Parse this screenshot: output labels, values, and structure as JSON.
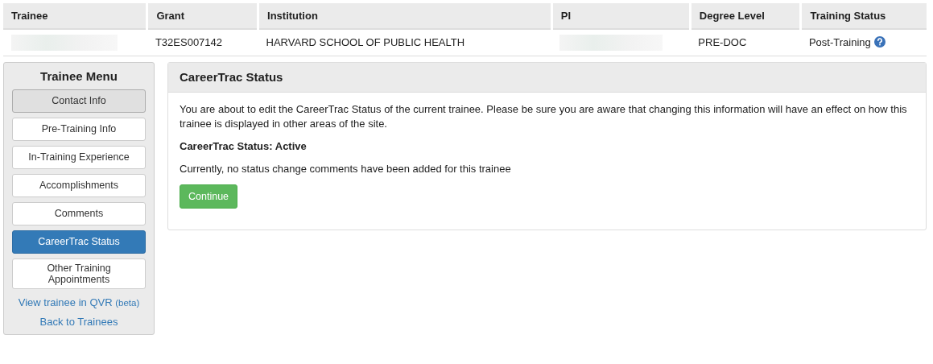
{
  "table": {
    "columns": [
      "Trainee",
      "Grant",
      "Institution",
      "PI",
      "Degree Level",
      "Training Status"
    ],
    "rows": [
      {
        "cells": [
          {
            "kind": "redacted"
          },
          {
            "kind": "text",
            "text": "T32ES007142"
          },
          {
            "kind": "text",
            "text": "HARVARD SCHOOL OF PUBLIC HEALTH"
          },
          {
            "kind": "redacted"
          },
          {
            "kind": "text",
            "text": "PRE-DOC"
          },
          {
            "kind": "help",
            "text": "Post-Training"
          }
        ]
      }
    ]
  },
  "sidebar": {
    "title": "Trainee Menu",
    "items": [
      {
        "label": "Contact Info",
        "selected": false,
        "hovered": true
      },
      {
        "label": "Pre-Training Info",
        "selected": false,
        "hovered": false
      },
      {
        "label": "In-Training Experience",
        "selected": false,
        "hovered": false
      },
      {
        "label": "Accomplishments",
        "selected": false,
        "hovered": false
      },
      {
        "label": "Comments",
        "selected": false,
        "hovered": false
      },
      {
        "label": "CareerTrac Status",
        "selected": true,
        "hovered": false
      },
      {
        "label": "Other Training Appointments",
        "selected": false,
        "hovered": false
      }
    ],
    "links": [
      {
        "label": "View trainee in QVR",
        "note": "(beta)"
      },
      {
        "label": "Back to Trainees"
      }
    ]
  },
  "panel": {
    "title": "CareerTrac Status",
    "intro": "You are about to edit the CareerTrac Status of the current trainee. Please be sure you are aware that changing this information will have an effect on how this trainee is displayed in other areas of the site.",
    "status": "CareerTrac Status: Active",
    "comments": "Currently, no status change comments have been added for this trainee",
    "button": "Continue"
  }
}
